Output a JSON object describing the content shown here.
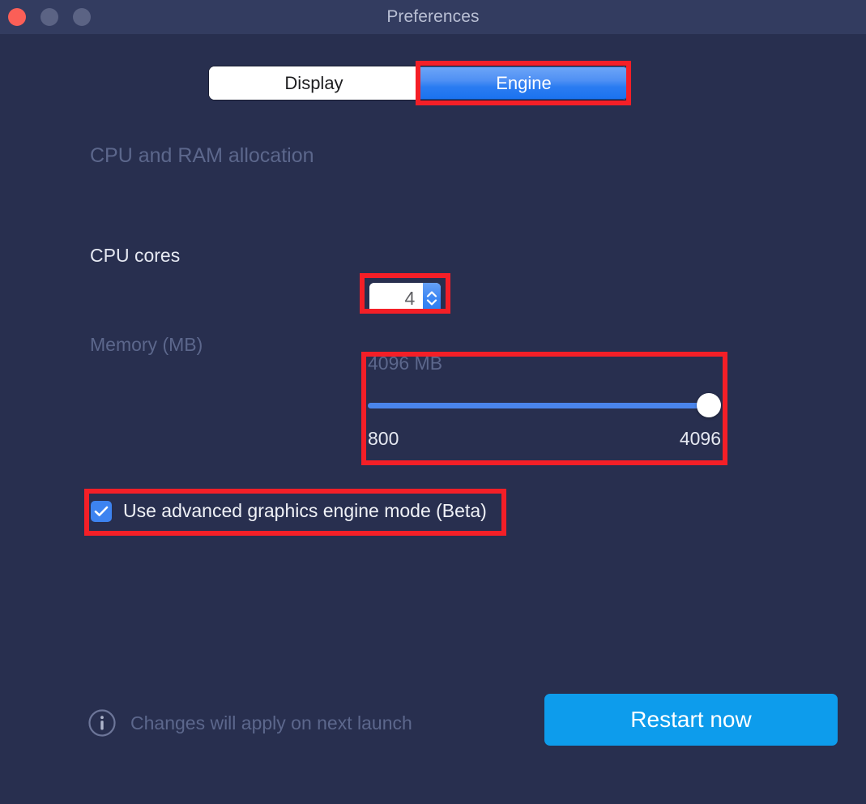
{
  "window": {
    "title": "Preferences",
    "traffic_lights": [
      {
        "name": "close",
        "color": "#fb5f57"
      },
      {
        "name": "minimize",
        "color": "#5b6384"
      },
      {
        "name": "zoom",
        "color": "#5b6384"
      }
    ]
  },
  "tabs": [
    {
      "label": "Display",
      "active": false
    },
    {
      "label": "Engine",
      "active": true
    }
  ],
  "section": {
    "heading": "CPU and RAM allocation"
  },
  "cpu": {
    "label": "CPU cores",
    "value": "4",
    "placeholder": "4"
  },
  "memory": {
    "label": "Memory (MB)",
    "value_text": "4096 MB",
    "min_label": "800",
    "max_label": "4096",
    "min": 800,
    "max": 4096,
    "value": 4096,
    "percent": 100
  },
  "advanced_graphics": {
    "label": "Use advanced graphics engine mode (Beta)",
    "checked": true
  },
  "footer": {
    "note": "Changes will apply on next launch",
    "restart_label": "Restart now"
  },
  "annotations": {
    "highlight_color": "#f41f27",
    "boxes": [
      "engine-tab",
      "cpu-spinner",
      "memory-slider",
      "advanced-graphics-checkbox"
    ]
  },
  "colors": {
    "window_background": "#282f4f",
    "titlebar_background": "#333c60",
    "accent_blue": "#3d83f0",
    "primary_button": "#0d9cec",
    "muted_text": "#5c678c",
    "bright_text": "#e6e9f2"
  }
}
